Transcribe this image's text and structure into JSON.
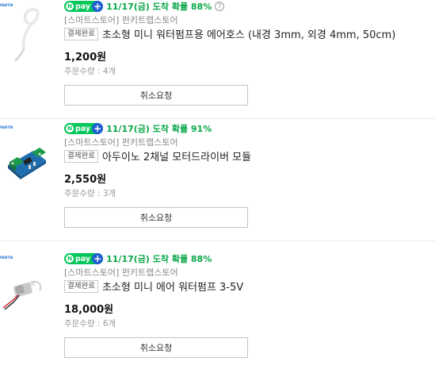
{
  "common": {
    "npay_label": "pay",
    "npay_n": "N",
    "npay_plus": "+",
    "status_badge": "결제완료",
    "cancel_label": "취소요청",
    "store": "[스마트스토어] 펀키트랩스토어",
    "thumb_tag": "PANTIB"
  },
  "orders": [
    {
      "eta": "11/17(금) 도착 확률 88%",
      "product": "초소형 미니 워터펌프용 에어호스 (내경 3mm, 외경 4mm, 50cm)",
      "price": "1,200원",
      "quantity": "주문수량 : 4개",
      "image": "air-hose"
    },
    {
      "eta": "11/17(금) 도착 확률 91%",
      "product": "아두이노 2채널 모터드라이버 모듈",
      "price": "2,550원",
      "quantity": "주문수량 : 3개",
      "image": "motor-driver-module"
    },
    {
      "eta": "11/17(금) 도착 확률 88%",
      "product": "초소형 미니 에어 워터펌프 3-5V",
      "price": "18,000원",
      "quantity": "주문수량 : 6개",
      "image": "mini-air-pump"
    }
  ],
  "colors": {
    "npay_green": "#03c75a",
    "eta_green": "#08a646",
    "plus_blue": "#1f5fd1"
  }
}
